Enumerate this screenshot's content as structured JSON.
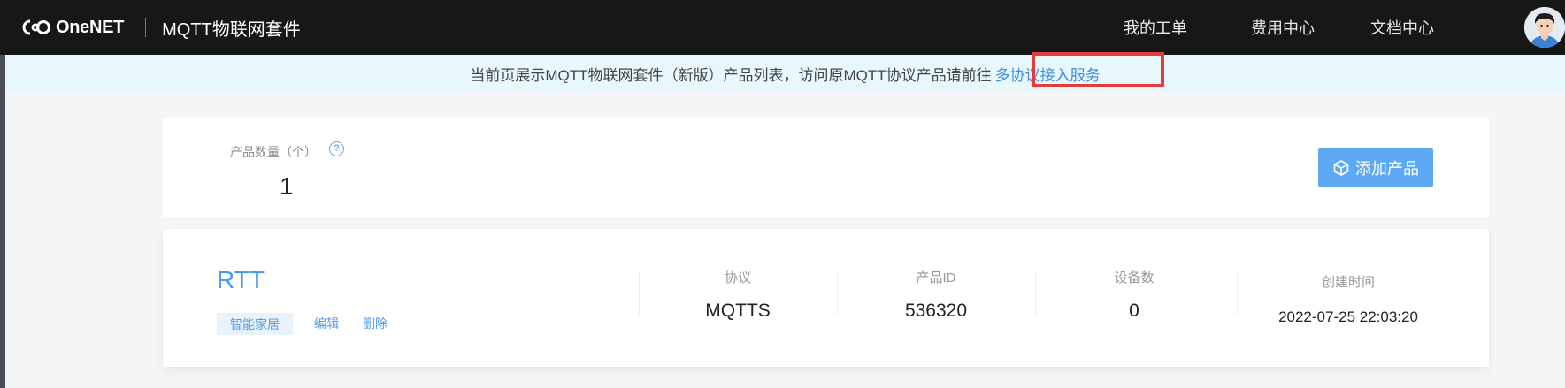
{
  "topbar": {
    "logo_text": "OneNET",
    "suite_title": "MQTT物联网套件",
    "nav": [
      "我的工单",
      "费用中心",
      "文档中心"
    ]
  },
  "notice": {
    "text": "当前页展示MQTT物联网套件（新版）产品列表，访问原MQTT协议产品请前往",
    "link": "多协议接入服务"
  },
  "summary": {
    "count_label": "产品数量（个）",
    "count_value": "1",
    "add_button": "添加产品"
  },
  "product": {
    "name": "RTT",
    "tag": "智能家居",
    "actions": [
      "编辑",
      "删除"
    ],
    "columns": [
      {
        "label": "协议",
        "value": "MQTTS"
      },
      {
        "label": "产品ID",
        "value": "536320"
      },
      {
        "label": "设备数",
        "value": "0"
      },
      {
        "label": "创建时间",
        "value": "2022-07-25 22:03:20"
      }
    ]
  },
  "colors": {
    "topbar_bg": "#171717",
    "accent": "#4a9af0",
    "button_bg": "#5ea9f5",
    "notice_bg": "#e8f7fc",
    "highlight": "#e43b3b"
  },
  "icons": [
    "onenet-logo-icon",
    "help-icon",
    "box-icon",
    "user-avatar"
  ]
}
